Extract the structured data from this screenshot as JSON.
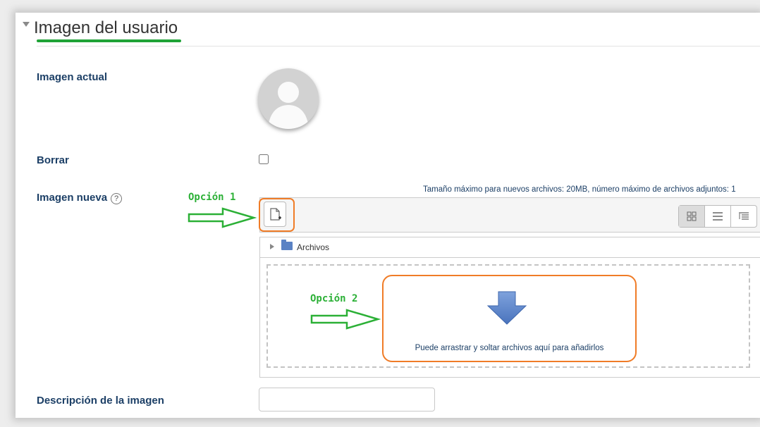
{
  "section": {
    "title": "Imagen del usuario",
    "accent_color": "#1fa337"
  },
  "labels": {
    "current_image": "Imagen actual",
    "delete": "Borrar",
    "new_image": "Imagen nueva",
    "description": "Descripción de la imagen"
  },
  "help_icon": "?",
  "delete_checked": false,
  "annotations": {
    "option1": "Opción 1",
    "option2": "Opción 2",
    "arrow_color": "#2bb036",
    "highlight_color": "#f07c27"
  },
  "filemanager": {
    "max_info": "Tamaño máximo para nuevos archivos: 20MB, número máximo de archivos adjuntos: 1",
    "folder_label": "Archivos",
    "drop_text": "Puede arrastrar y soltar archivos aquí para añadirlos",
    "views": [
      "icons-view-icon",
      "list-view-icon",
      "tree-view-icon"
    ],
    "active_view": "icons-view-icon"
  },
  "description_input": {
    "value": "",
    "placeholder": ""
  }
}
